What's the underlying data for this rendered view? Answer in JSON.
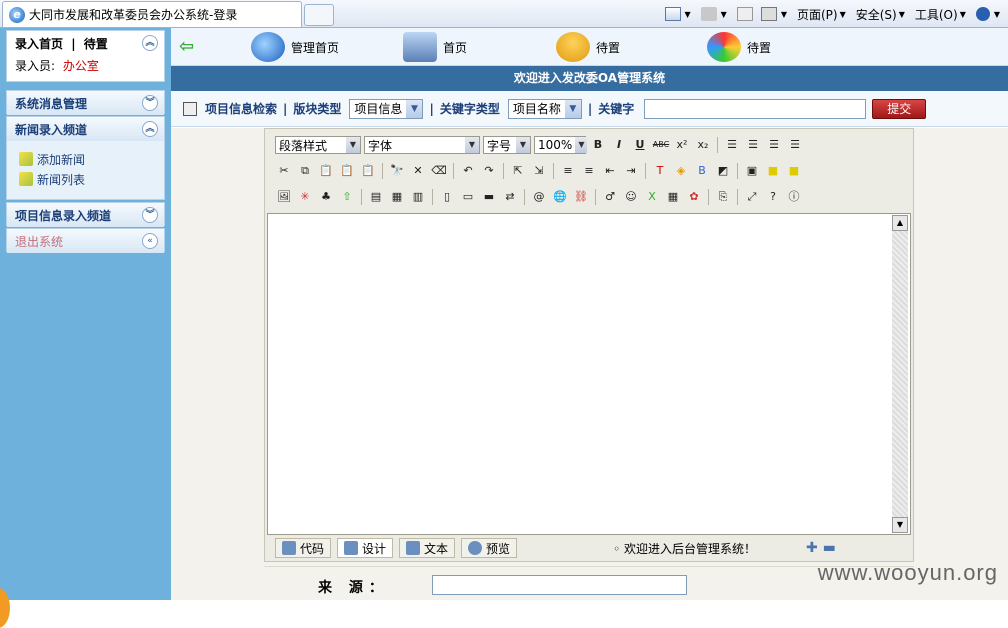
{
  "browser": {
    "tab_title": "大同市发展和改革委员会办公系统-登录",
    "menu": {
      "page": "页面(P)",
      "safety": "安全(S)",
      "tools": "工具(O)"
    }
  },
  "sidebar": {
    "top": {
      "home": "录入首页",
      "sep": "|",
      "pending": "待置",
      "user_label": "录入员:",
      "user_value": "办公室"
    },
    "sections": [
      {
        "title": "系统消息管理"
      },
      {
        "title": "新闻录入频道",
        "items": [
          "添加新闻",
          "新闻列表"
        ]
      },
      {
        "title": "项目信息录入频道"
      },
      {
        "title": "退出系统"
      }
    ]
  },
  "nav": {
    "items": [
      "管理首页",
      "首页",
      "待置",
      "待置"
    ]
  },
  "banner": "欢迎进入发改委OA管理系统",
  "search": {
    "title": "项目信息检索",
    "block_label": "版块类型",
    "block_value": "项目信息",
    "kwtype_label": "关键字类型",
    "kwtype_value": "项目名称",
    "kw_label": "关键字",
    "submit": "提交",
    "sep": "|"
  },
  "editor": {
    "paragraph": "段落样式",
    "font": "字体",
    "size": "字号",
    "zoom": "100%",
    "tabs": [
      "代码",
      "设计",
      "文本",
      "预览"
    ],
    "status": "欢迎进入后台管理系统！"
  },
  "form": {
    "source_label": "来  源："
  },
  "watermark": "www.wooyun.org"
}
